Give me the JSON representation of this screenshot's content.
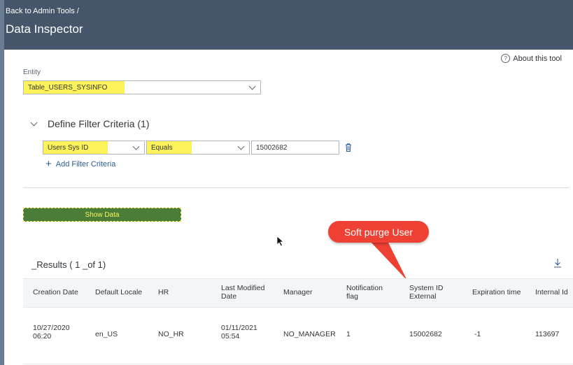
{
  "header": {
    "back_link": "Back to Admin Tools",
    "separator": "/",
    "title": "Data Inspector"
  },
  "about_link": "About this tool",
  "entity": {
    "label": "Entity",
    "value": "Table_USERS_SYSINFO"
  },
  "filter": {
    "section_title": "Define Filter Criteria (1)",
    "field": "Users Sys ID",
    "operator": "Equals",
    "value": "15002682",
    "add_label": "Add Filter Criteria"
  },
  "show_data_label": "Show Data",
  "annotation": "Soft  purge User",
  "results": {
    "title": "_Results ( 1 _of 1)",
    "columns": [
      "Creation Date",
      "Default Locale",
      "HR",
      "Last Modified Date",
      "Manager",
      "Notification flag",
      "System ID External",
      "Expiration time",
      "Internal Id"
    ],
    "row": [
      "10/27/2020 06:20",
      "en_US",
      "NO_HR",
      "01/11/2021 05:54",
      "NO_MANAGER",
      "1",
      "15002682",
      "-1",
      "113697"
    ]
  },
  "colors": {
    "header_bg": "#45556a",
    "highlight": "#fdf25a",
    "button_green": "#4a7d38",
    "callout_red": "#ef4034",
    "link_blue": "#2c5c8f"
  }
}
